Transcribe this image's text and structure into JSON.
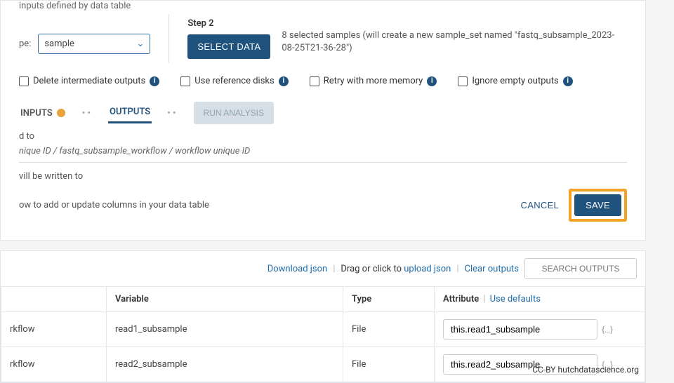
{
  "top": {
    "inputs_note": "inputs defined by data table",
    "type_label": "pe:",
    "type_value": "sample",
    "step2_label": "Step 2",
    "select_data_btn": "SELECT DATA",
    "selected_desc": "8 selected samples (will create a new sample_set named \"fastq_subsample_2023-08-25T21-36-28\")"
  },
  "options": {
    "delete_intermediate": "Delete intermediate outputs",
    "use_reference_disks": "Use reference disks",
    "retry_memory": "Retry with more memory",
    "ignore_empty": "Ignore empty outputs"
  },
  "tabs": {
    "inputs": "INPUTS",
    "outputs": "OUTPUTS",
    "run_analysis": "RUN ANALYSIS"
  },
  "paths": {
    "line1_prefix": "d to",
    "path": "nique ID / fastq_subsample_workflow / workflow unique ID",
    "written_to": "vill be written to",
    "help": "ow to add or update columns in your data table"
  },
  "actions": {
    "cancel": "CANCEL",
    "save": "SAVE"
  },
  "outputs_toolbar": {
    "download_json": "Download json",
    "drag_prefix": "Drag or click to ",
    "upload_json": "upload json",
    "clear_outputs": "Clear outputs",
    "search_placeholder": "SEARCH OUTPUTS"
  },
  "table": {
    "headers": {
      "task": "",
      "variable": "Variable",
      "type": "Type",
      "attribute": "Attribute",
      "use_defaults": "Use defaults"
    },
    "rows": [
      {
        "task": "rkflow",
        "variable": "read1_subsample",
        "type": "File",
        "attribute": "this.read1_subsample"
      },
      {
        "task": "rkflow",
        "variable": "read2_subsample",
        "type": "File",
        "attribute": "this.read2_subsample"
      }
    ]
  },
  "attribution": "CC-BY  hutchdatascience.org"
}
